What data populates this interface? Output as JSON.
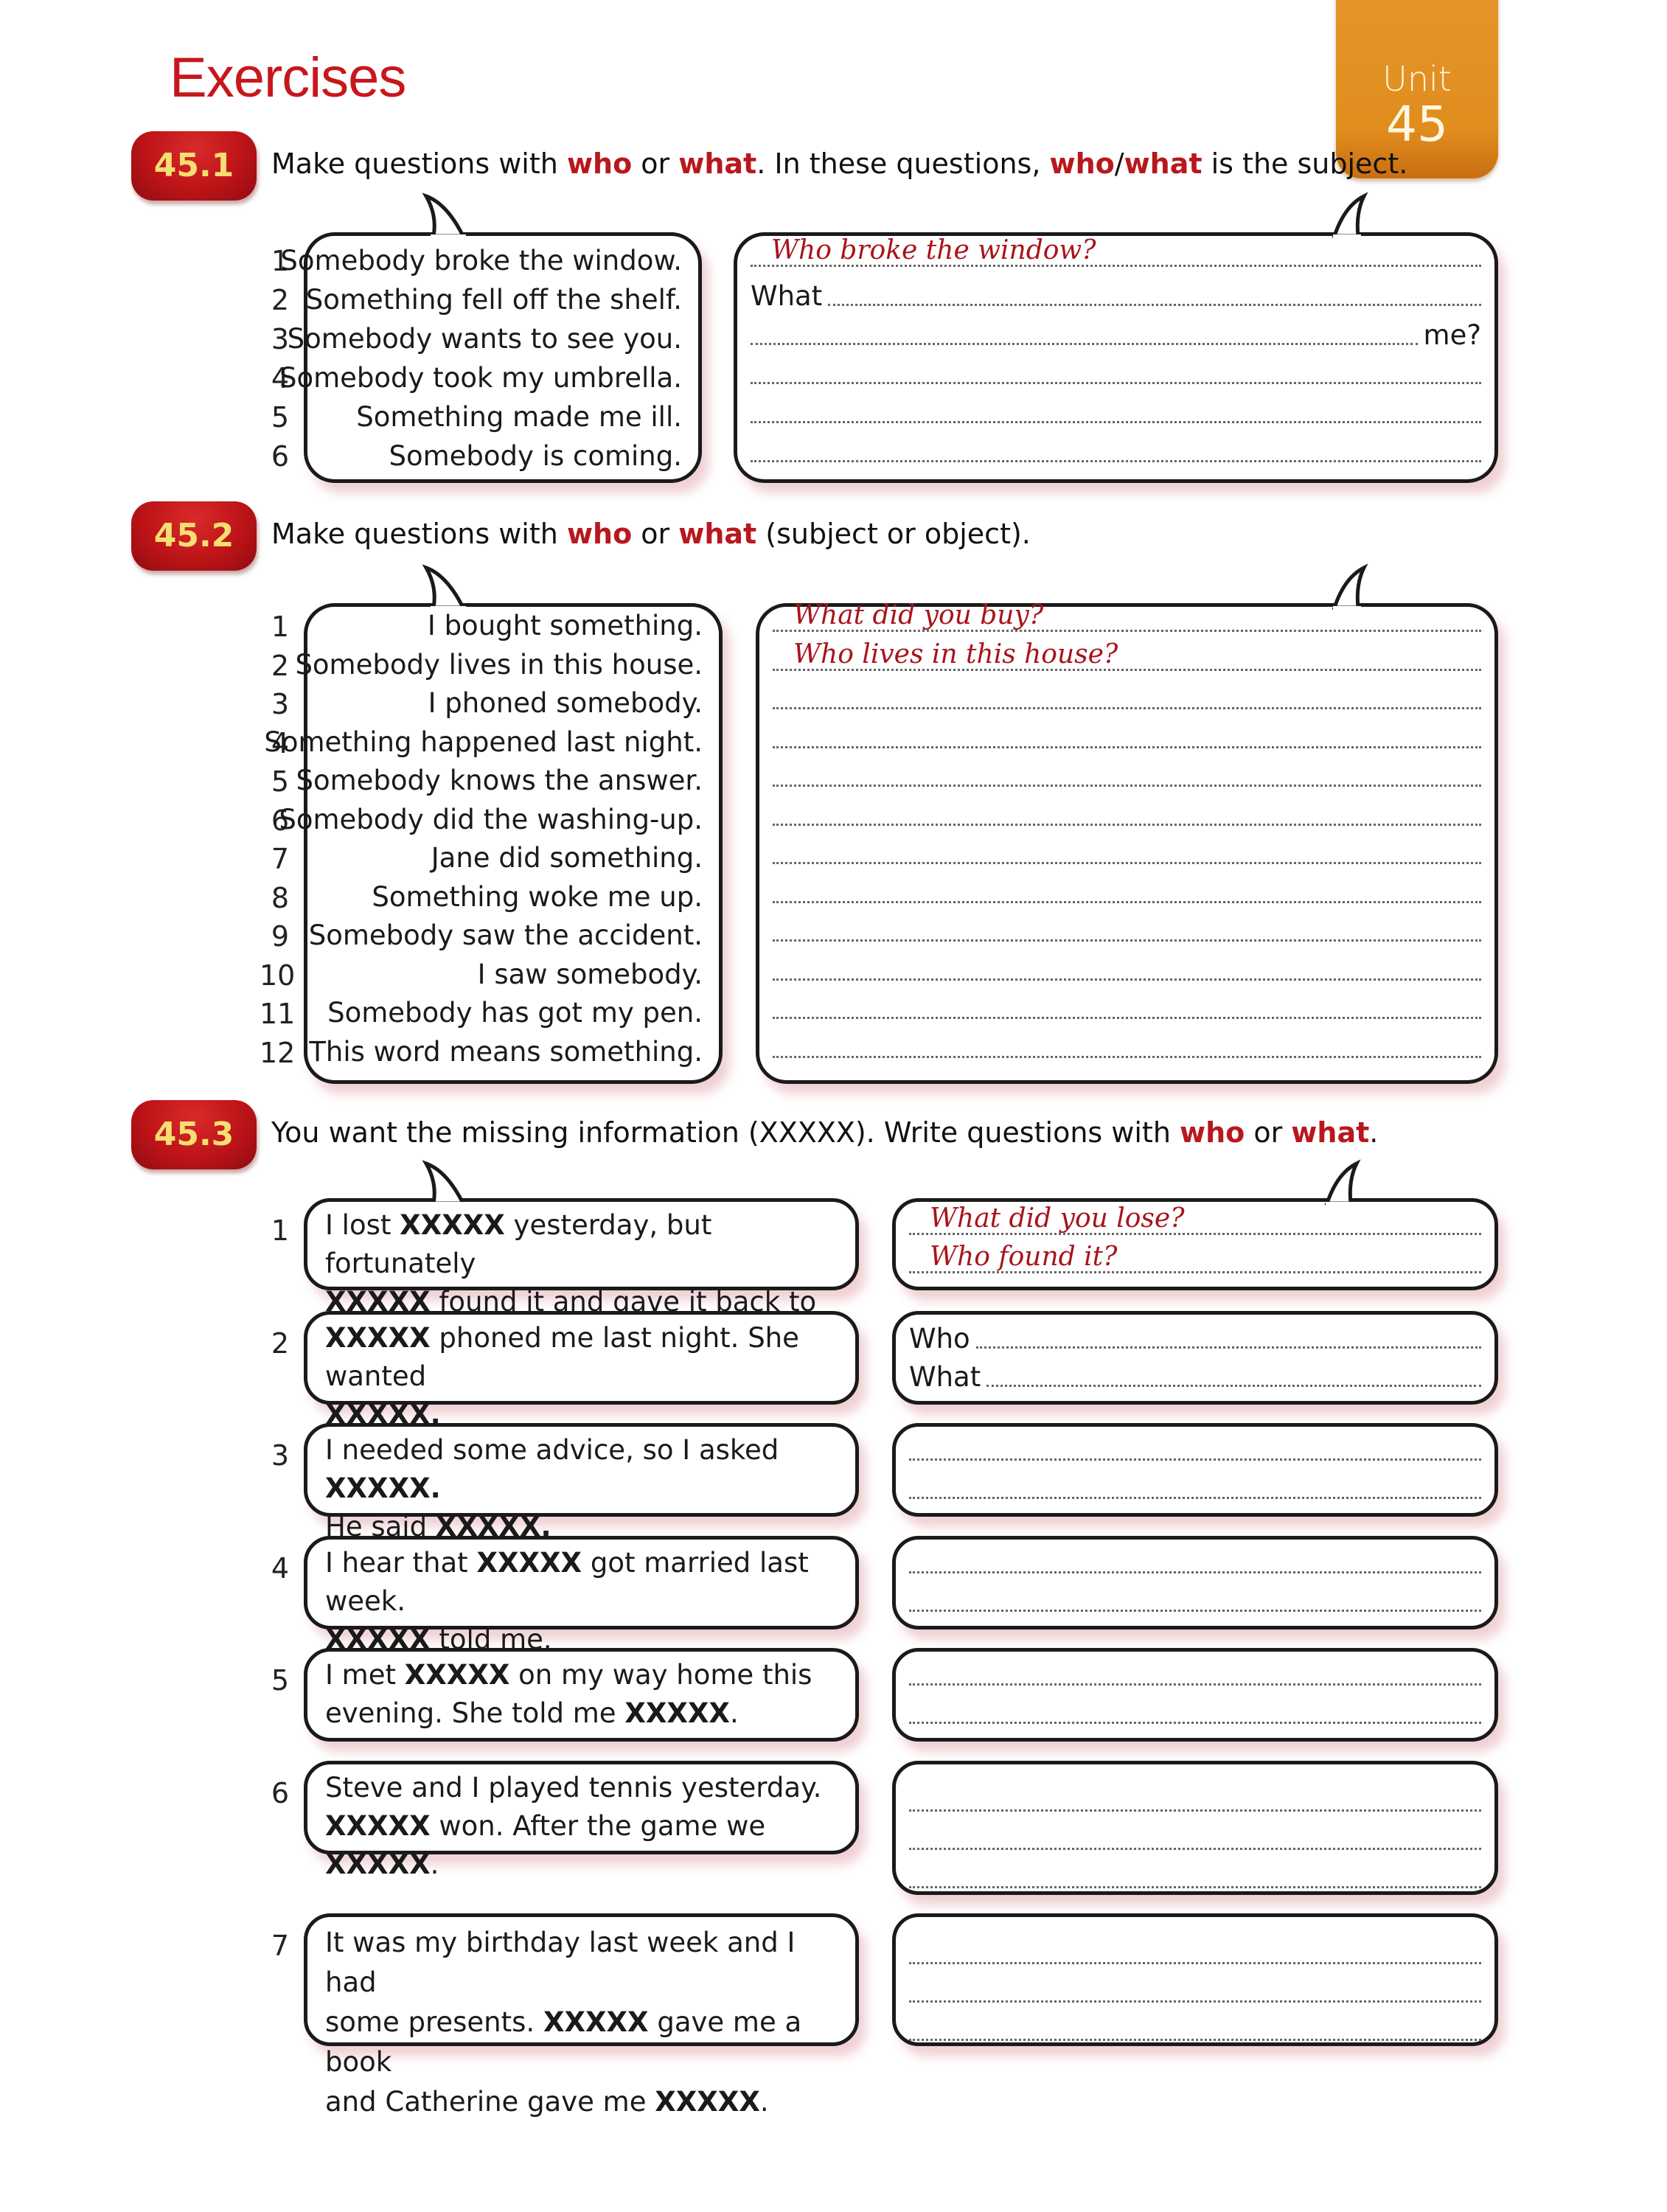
{
  "header": {
    "title": "Exercises",
    "unit_label": "Unit",
    "unit_number": "45"
  },
  "colors": {
    "heading_red": "#c8161d",
    "keyword_red": "#b8181d",
    "badge_red": "#bd1418",
    "badge_text": "#f5df72",
    "unit_tab_orange": "#e08d1e",
    "answer_red": "#a8141b"
  },
  "ex1": {
    "badge": "45.1",
    "instruction": [
      {
        "t": "Make questions with "
      },
      {
        "t": "who",
        "k": true
      },
      {
        "t": " or "
      },
      {
        "t": "what",
        "k": true
      },
      {
        "t": ".  In these questions, "
      },
      {
        "t": "who",
        "k": true
      },
      {
        "t": "/"
      },
      {
        "t": "what",
        "k": true
      },
      {
        "t": " is the subject."
      }
    ],
    "items": [
      {
        "n": "1",
        "text": "Somebody broke the window."
      },
      {
        "n": "2",
        "text": "Something fell off the shelf."
      },
      {
        "n": "3",
        "text": "Somebody wants to see you."
      },
      {
        "n": "4",
        "text": "Somebody took my umbrella."
      },
      {
        "n": "5",
        "text": "Something made me ill."
      },
      {
        "n": "6",
        "text": "Somebody is coming."
      }
    ],
    "answers": [
      {
        "answer": "Who broke the window?",
        "prefix": "",
        "suffix": ""
      },
      {
        "answer": "",
        "prefix": "What",
        "suffix": ""
      },
      {
        "answer": "",
        "prefix": "",
        "suffix": "me?"
      },
      {
        "answer": "",
        "prefix": "",
        "suffix": ""
      },
      {
        "answer": "",
        "prefix": "",
        "suffix": ""
      },
      {
        "answer": "",
        "prefix": "",
        "suffix": ""
      }
    ]
  },
  "ex2": {
    "badge": "45.2",
    "instruction": [
      {
        "t": "Make questions with "
      },
      {
        "t": "who",
        "k": true
      },
      {
        "t": " or "
      },
      {
        "t": "what",
        "k": true
      },
      {
        "t": " (subject or object)."
      }
    ],
    "items": [
      {
        "n": "1",
        "text": "I bought something."
      },
      {
        "n": "2",
        "text": "Somebody lives in this house."
      },
      {
        "n": "3",
        "text": "I phoned somebody."
      },
      {
        "n": "4",
        "text": "Something happened last night."
      },
      {
        "n": "5",
        "text": "Somebody knows the answer."
      },
      {
        "n": "6",
        "text": "Somebody did the washing-up."
      },
      {
        "n": "7",
        "text": "Jane did something."
      },
      {
        "n": "8",
        "text": "Something woke me up."
      },
      {
        "n": "9",
        "text": "Somebody saw the accident."
      },
      {
        "n": "10",
        "text": "I saw somebody."
      },
      {
        "n": "11",
        "text": "Somebody has got my pen."
      },
      {
        "n": "12",
        "text": "This word means something."
      }
    ],
    "answers": [
      {
        "answer": "What did you buy?"
      },
      {
        "answer": "Who lives in this house?"
      },
      {
        "answer": ""
      },
      {
        "answer": ""
      },
      {
        "answer": ""
      },
      {
        "answer": ""
      },
      {
        "answer": ""
      },
      {
        "answer": ""
      },
      {
        "answer": ""
      },
      {
        "answer": ""
      },
      {
        "answer": ""
      },
      {
        "answer": ""
      }
    ]
  },
  "ex3": {
    "badge": "45.3",
    "instruction": [
      {
        "t": "You want the missing information (XXXXX).  Write questions with "
      },
      {
        "t": "who",
        "k": true
      },
      {
        "t": " or "
      },
      {
        "t": "what",
        "k": true
      },
      {
        "t": "."
      }
    ],
    "items": [
      {
        "n": "1",
        "lines": [
          [
            {
              "t": "I lost "
            },
            {
              "t": "XXXXX",
              "b": true
            },
            {
              "t": " yesterday, but fortunately"
            }
          ],
          [
            {
              "t": "XXXXX",
              "b": true
            },
            {
              "t": " found it and gave it back to me."
            }
          ]
        ],
        "answers": [
          {
            "answer": "What did you lose?",
            "prefix": ""
          },
          {
            "answer": "Who found it?",
            "prefix": ""
          }
        ]
      },
      {
        "n": "2",
        "lines": [
          [
            {
              "t": "XXXXX",
              "b": true
            },
            {
              "t": " phoned me last night.  She wanted"
            }
          ],
          [
            {
              "t": "XXXXX.",
              "b": true
            }
          ]
        ],
        "answers": [
          {
            "answer": "",
            "prefix": "Who"
          },
          {
            "answer": "",
            "prefix": "What"
          }
        ]
      },
      {
        "n": "3",
        "lines": [
          [
            {
              "t": "I needed some advice, so I asked "
            },
            {
              "t": "XXXXX.",
              "b": true
            }
          ],
          [
            {
              "t": "He said "
            },
            {
              "t": "XXXXX.",
              "b": true
            }
          ]
        ],
        "answers": [
          {
            "answer": "",
            "prefix": ""
          },
          {
            "answer": "",
            "prefix": ""
          }
        ]
      },
      {
        "n": "4",
        "lines": [
          [
            {
              "t": "I hear that "
            },
            {
              "t": "XXXXX",
              "b": true
            },
            {
              "t": " got married last week."
            }
          ],
          [
            {
              "t": "XXXXX",
              "b": true
            },
            {
              "t": " told me."
            }
          ]
        ],
        "answers": [
          {
            "answer": "",
            "prefix": ""
          },
          {
            "answer": "",
            "prefix": ""
          }
        ]
      },
      {
        "n": "5",
        "lines": [
          [
            {
              "t": "I met "
            },
            {
              "t": "XXXXX",
              "b": true
            },
            {
              "t": " on my way home this"
            }
          ],
          [
            {
              "t": "evening.  She told me "
            },
            {
              "t": "XXXXX",
              "b": true
            },
            {
              "t": "."
            }
          ]
        ],
        "answers": [
          {
            "answer": "",
            "prefix": ""
          },
          {
            "answer": "",
            "prefix": ""
          }
        ]
      },
      {
        "n": "6",
        "lines": [
          [
            {
              "t": "Steve and I played tennis yesterday."
            }
          ],
          [
            {
              "t": "XXXXX",
              "b": true
            },
            {
              "t": " won.  After the game we "
            },
            {
              "t": "XXXXX",
              "b": true
            },
            {
              "t": "."
            }
          ]
        ],
        "answers": [
          {
            "answer": "",
            "prefix": ""
          },
          {
            "answer": "",
            "prefix": ""
          },
          {
            "answer": "",
            "prefix": ""
          }
        ]
      },
      {
        "n": "7",
        "lines": [
          [
            {
              "t": "It was my birthday last week and I had"
            }
          ],
          [
            {
              "t": "some presents.  "
            },
            {
              "t": "XXXXX",
              "b": true
            },
            {
              "t": " gave me a book"
            }
          ],
          [
            {
              "t": "and Catherine gave me "
            },
            {
              "t": "XXXXX",
              "b": true
            },
            {
              "t": "."
            }
          ]
        ],
        "answers": [
          {
            "answer": "",
            "prefix": ""
          },
          {
            "answer": "",
            "prefix": ""
          },
          {
            "answer": "",
            "prefix": ""
          }
        ]
      }
    ]
  }
}
